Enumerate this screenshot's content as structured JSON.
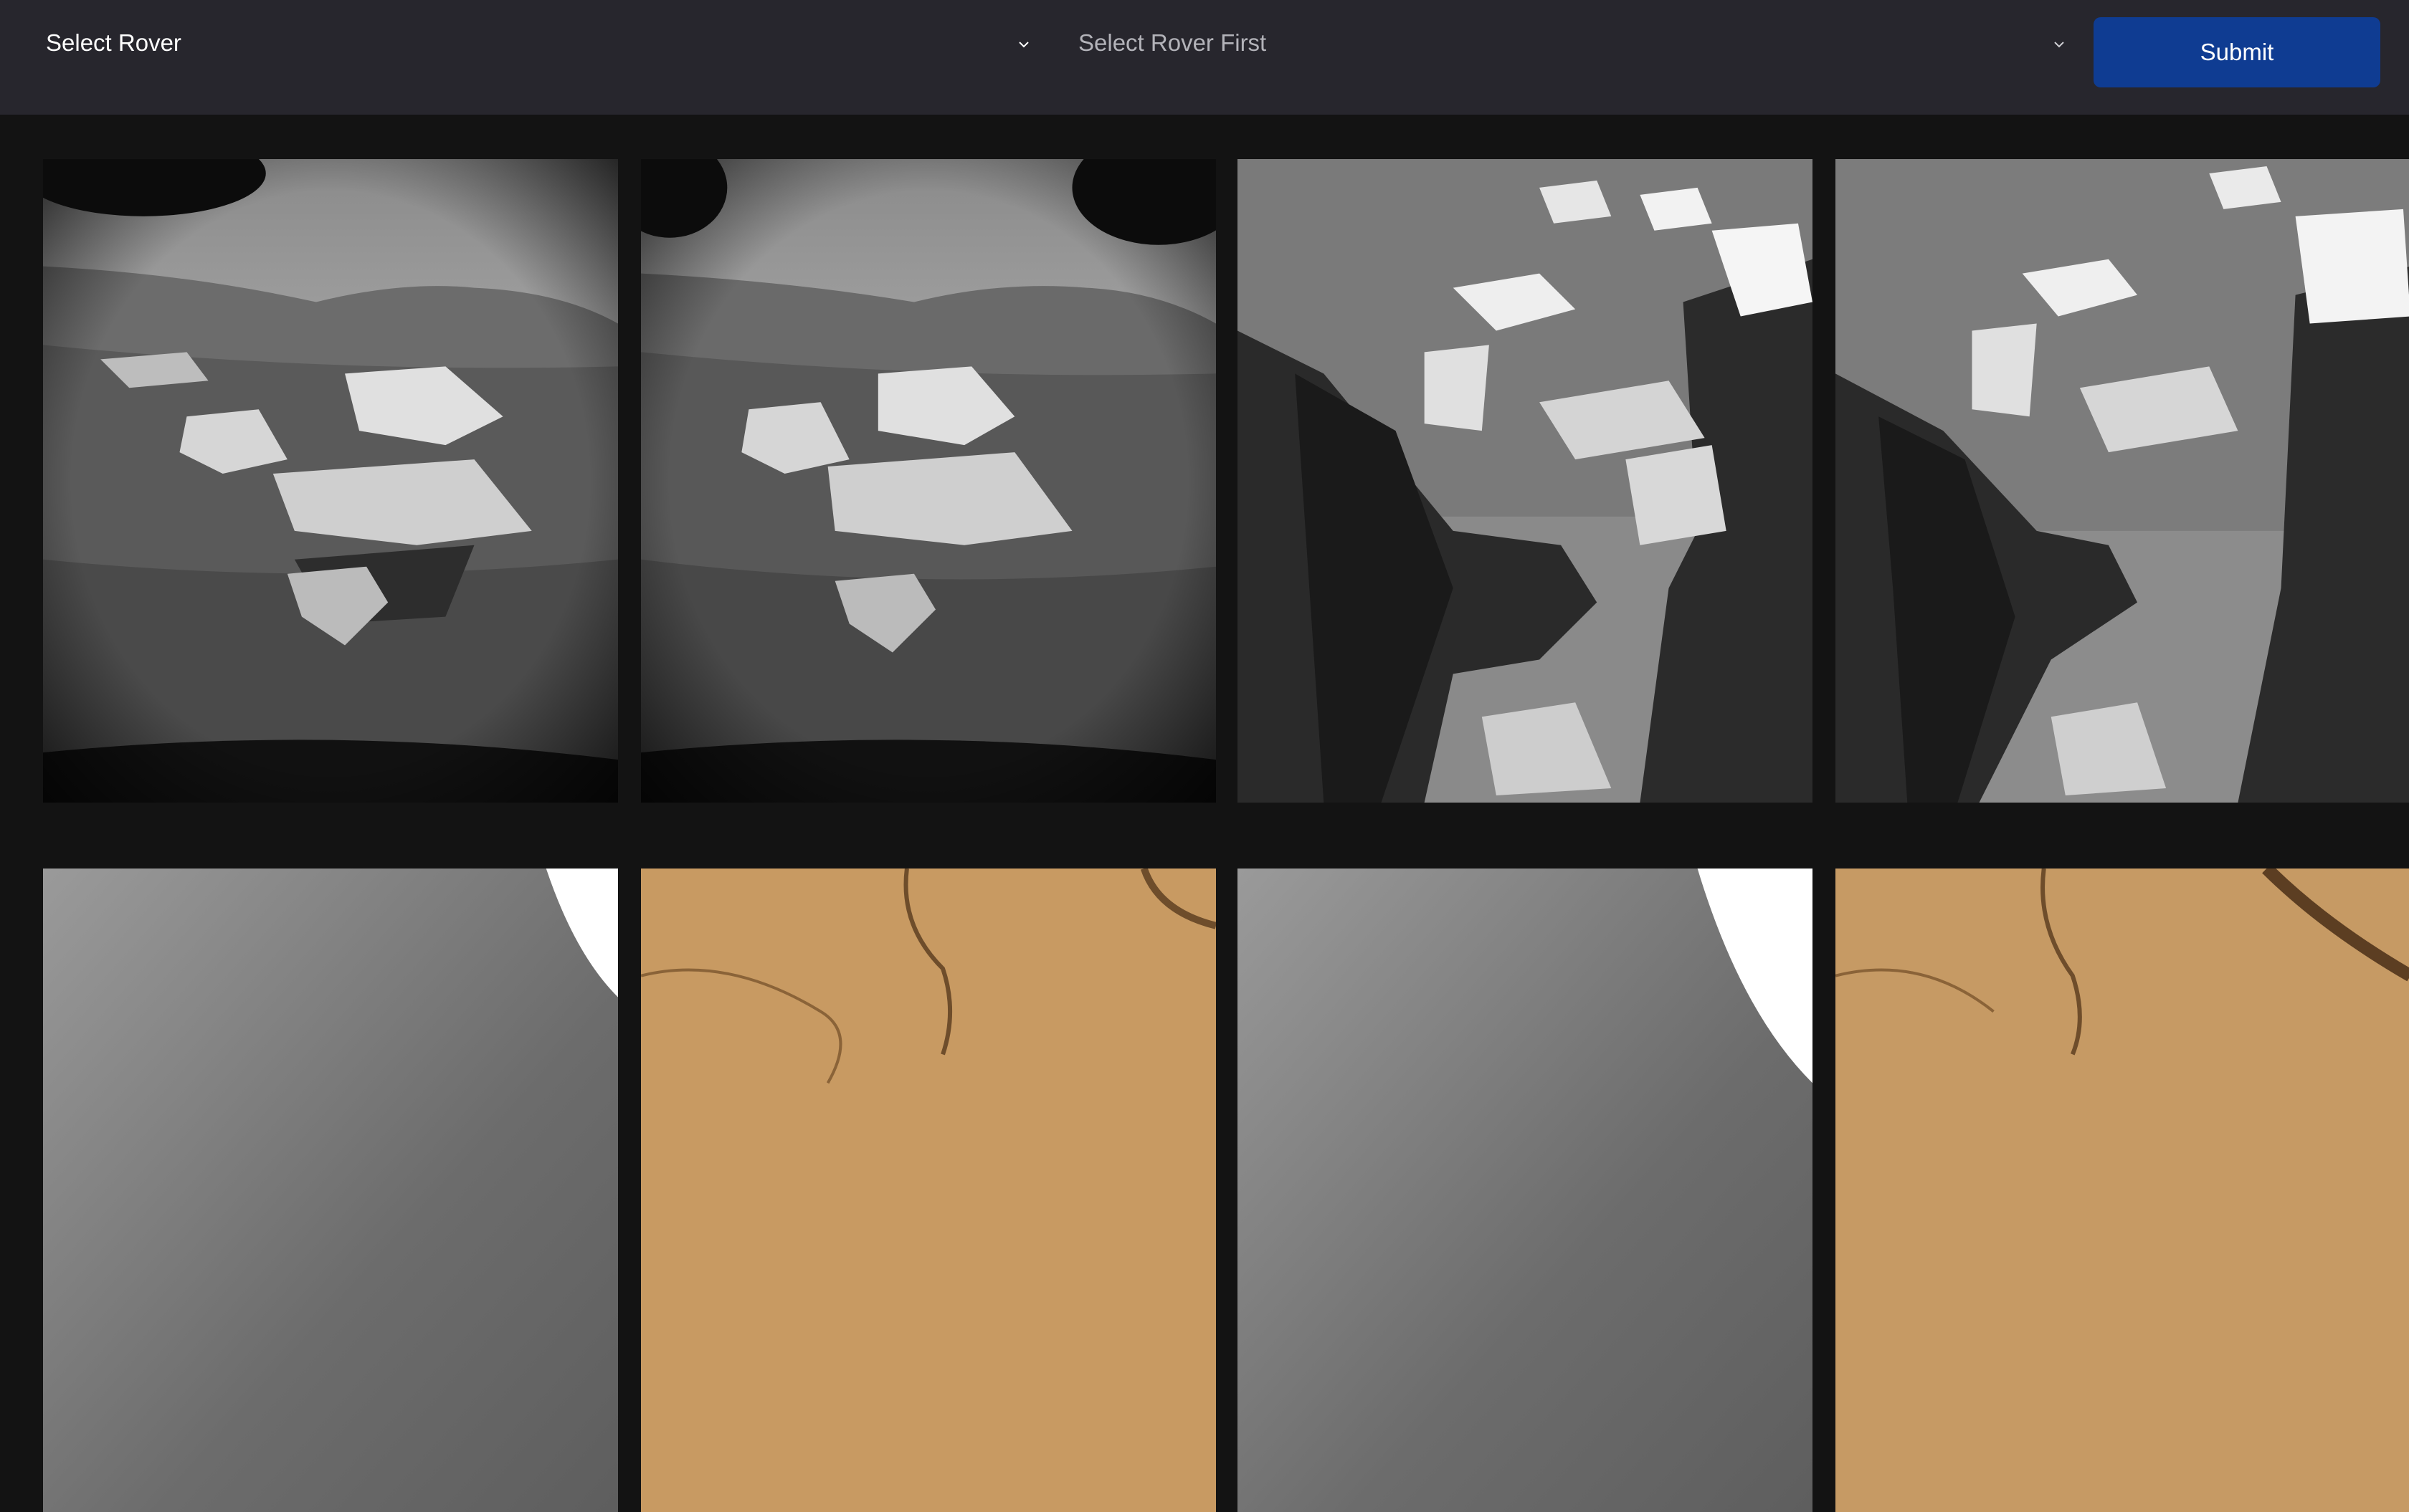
{
  "header": {
    "rover_select": {
      "value": "Select Rover"
    },
    "camera_select": {
      "value": "Select Rover First"
    },
    "submit_label": "Submit"
  },
  "gallery": {
    "rows": [
      [
        {
          "kind": "navcam-rocks-left",
          "tone": "grayscale"
        },
        {
          "kind": "navcam-rocks-right",
          "tone": "grayscale"
        },
        {
          "kind": "hazcam-shadow-left",
          "tone": "grayscale"
        },
        {
          "kind": "hazcam-shadow-right",
          "tone": "grayscale"
        }
      ],
      [
        {
          "kind": "blurry-gray",
          "tone": "grayscale"
        },
        {
          "kind": "tan-soil-cracks",
          "tone": "color"
        },
        {
          "kind": "blurry-gray",
          "tone": "grayscale"
        },
        {
          "kind": "tan-soil-cracks",
          "tone": "color"
        }
      ]
    ]
  },
  "colors": {
    "background": "#131313",
    "topbar": "#27262d",
    "submit": "#0f3c92",
    "placeholder_text": "#b3b3b9"
  }
}
